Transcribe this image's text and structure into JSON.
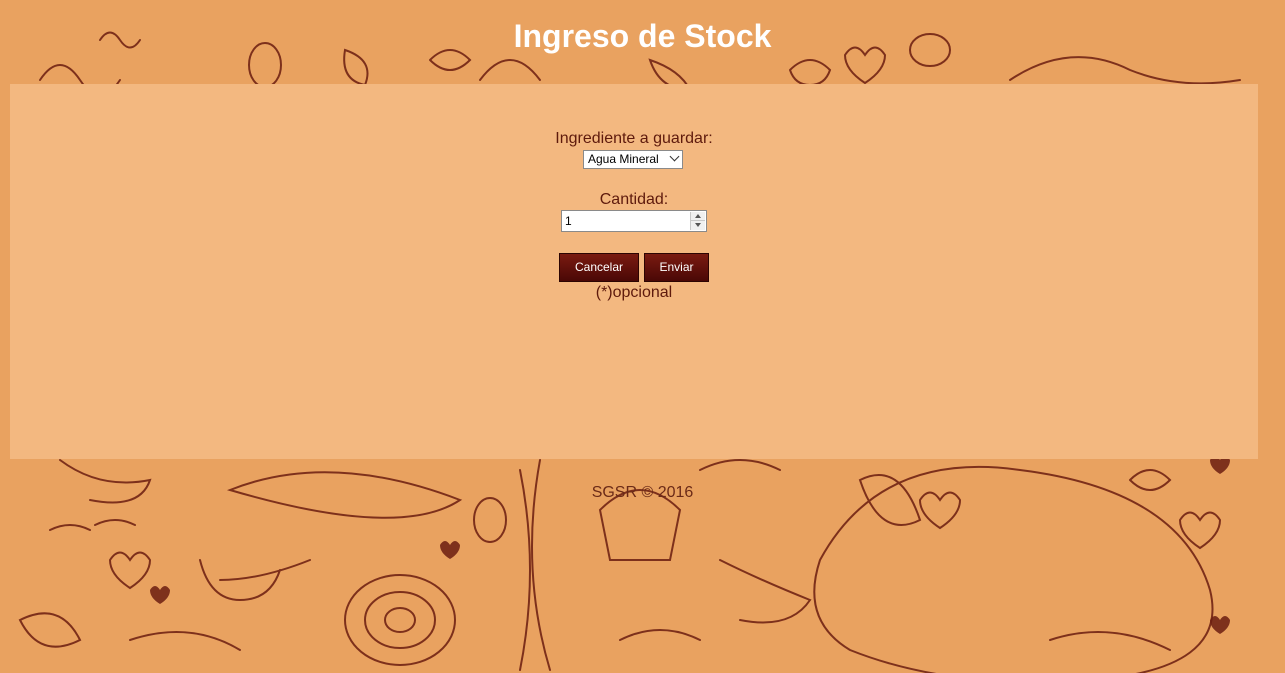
{
  "page": {
    "title": "Ingreso de Stock"
  },
  "form": {
    "ingredient_label": "Ingrediente a guardar:",
    "ingredient_selected": "Agua Mineral",
    "quantity_label": "Cantidad:",
    "quantity_value": "1",
    "cancel_label": "Cancelar",
    "send_label": "Enviar",
    "optional_note": "(*)opcional"
  },
  "footer": {
    "text": "SGSR © 2016"
  },
  "colors": {
    "background": "#e9a260",
    "panel": "#f3b880",
    "text": "#5e1a0c",
    "button": "#5a0d08"
  },
  "icons": {
    "select_arrow": "chevron-down-icon",
    "spinner_up": "caret-up-icon",
    "spinner_down": "caret-down-icon"
  }
}
